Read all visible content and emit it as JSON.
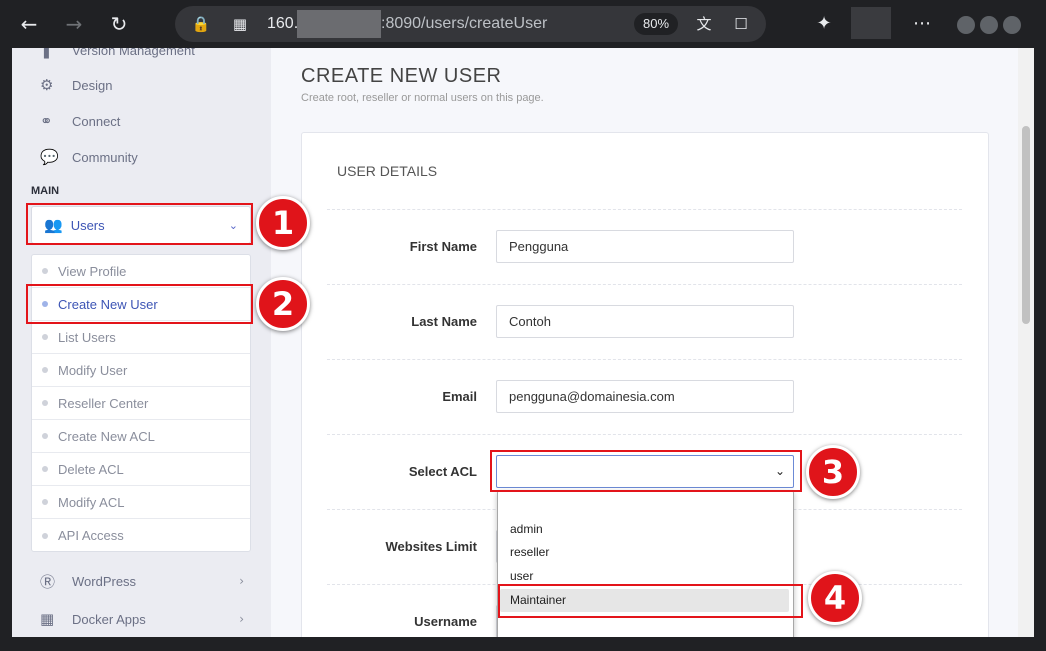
{
  "browser": {
    "url_host": "160.",
    "url_path": ":8090/users/createUser",
    "zoom": "80%",
    "icons": {
      "back": "arrow-left-icon",
      "forward": "arrow-right-icon",
      "reload": "reload-icon",
      "lock": "lock-icon",
      "site_settings": "site-settings-icon",
      "translate": "translate-icon",
      "bookmark": "bookmark-icon",
      "extensions": "puzzle-icon",
      "more": "more-icon"
    }
  },
  "sidebar": {
    "top_items": [
      {
        "label": "Version Management",
        "icon": "version-icon"
      },
      {
        "label": "Design",
        "icon": "gear-icon"
      },
      {
        "label": "Connect",
        "icon": "link-icon"
      },
      {
        "label": "Community",
        "icon": "chat-icon"
      }
    ],
    "section_heading": "MAIN",
    "users_menu": {
      "label": "Users",
      "icon": "users-icon"
    },
    "users_submenu": [
      {
        "label": "View Profile",
        "active": false
      },
      {
        "label": "Create New User",
        "active": true
      },
      {
        "label": "List Users",
        "active": false
      },
      {
        "label": "Modify User",
        "active": false
      },
      {
        "label": "Reseller Center",
        "active": false
      },
      {
        "label": "Create New ACL",
        "active": false
      },
      {
        "label": "Delete ACL",
        "active": false
      },
      {
        "label": "Modify ACL",
        "active": false
      },
      {
        "label": "API Access",
        "active": false
      }
    ],
    "bottom_items": [
      {
        "label": "WordPress",
        "icon": "wordpress-icon"
      },
      {
        "label": "Docker Apps",
        "icon": "docker-icon"
      }
    ]
  },
  "page": {
    "title": "CREATE NEW USER",
    "subtitle": "Create root, reseller or normal users on this page.",
    "section_title": "USER DETAILS",
    "fields": {
      "first_name": {
        "label": "First Name",
        "value": "Pengguna"
      },
      "last_name": {
        "label": "Last Name",
        "value": "Contoh"
      },
      "email": {
        "label": "Email",
        "value": "pengguna@domainesia.com"
      },
      "select_acl": {
        "label": "Select ACL",
        "value": ""
      },
      "websites_limit": {
        "label": "Websites Limit"
      },
      "username": {
        "label": "Username"
      }
    },
    "acl_options": [
      "",
      "admin",
      "reseller",
      "user",
      "Maintainer"
    ],
    "acl_highlighted": "Maintainer"
  },
  "annotations": [
    "1",
    "2",
    "3",
    "4"
  ],
  "colors": {
    "accent": "#3d55b5",
    "annotation_red": "#e3141a",
    "sidebar_bg": "#ebecf2"
  }
}
